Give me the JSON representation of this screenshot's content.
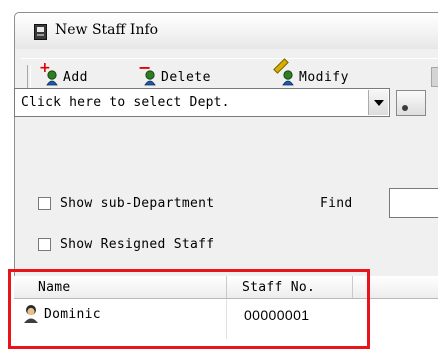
{
  "window": {
    "title": "New Staff Info"
  },
  "toolbar": {
    "add_label": "Add",
    "delete_label": "Delete",
    "modify_label": "Modify"
  },
  "dept_select": {
    "value": "Click here to select Dept."
  },
  "options": {
    "show_sub_department": {
      "label": "Show sub-Department",
      "checked": false
    },
    "show_resigned_staff": {
      "label": "Show Resigned Staff",
      "checked": false
    }
  },
  "find": {
    "label": "Find",
    "value": ""
  },
  "staff_table": {
    "columns": [
      "Name",
      "Staff No."
    ],
    "rows": [
      {
        "name": "Dominic",
        "staff_no": "00000001"
      }
    ]
  },
  "colors": {
    "highlight": "#e8141c",
    "accent_mark": "#e00000"
  },
  "icons": {
    "app": "staff-app-icon",
    "add": "add-person-icon",
    "delete": "delete-person-icon",
    "modify": "edit-person-icon",
    "row": "person-avatar-icon"
  }
}
